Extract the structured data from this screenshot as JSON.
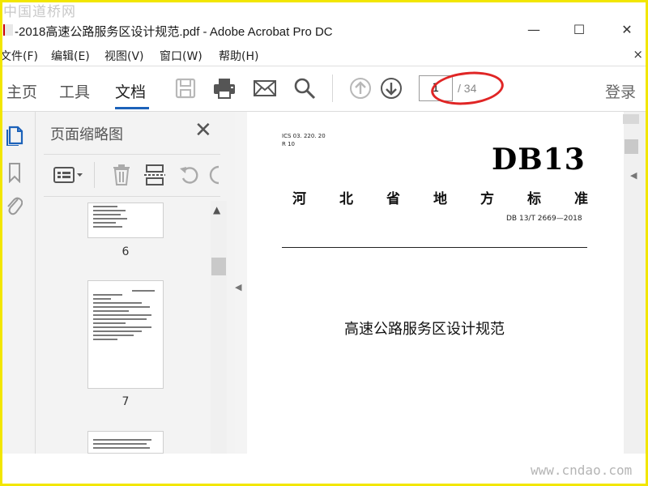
{
  "watermark_top": "中国道桥网",
  "watermark_bottom": "www.cndao.com",
  "window": {
    "title": "-2018高速公路服务区设计规范.pdf - Adobe Acrobat Pro DC",
    "minimize": "—",
    "maximize": "☐",
    "close": "✕"
  },
  "menu": {
    "items": [
      "文件(F)",
      "编辑(E)",
      "视图(V)",
      "窗口(W)",
      "帮助(H)"
    ],
    "close": "×"
  },
  "toolbar": {
    "tabs": [
      "主页",
      "工具",
      "文档"
    ],
    "active_tab": "文档",
    "icons": [
      "save-icon",
      "print-icon",
      "mail-icon",
      "search-icon",
      "page-up-icon",
      "page-down-icon"
    ],
    "page_current": "1",
    "page_total": "/ 34",
    "login": "登录"
  },
  "left_rail": {
    "icons": [
      "page-thumbnails-icon",
      "bookmark-icon",
      "attachment-icon"
    ]
  },
  "thumb_panel": {
    "title": "页面缩略图",
    "close": "✕",
    "tools": [
      "options-icon",
      "delete-icon",
      "insert-page-icon",
      "undo-icon",
      "redo-icon"
    ],
    "pages": [
      {
        "label": "6"
      },
      {
        "label": "7"
      }
    ]
  },
  "document": {
    "ics_line1": "ICS 03. 220. 20",
    "ics_line2": "R 10",
    "db_code": "DB13",
    "province_chars": [
      "河",
      "北",
      "省",
      "地",
      "方",
      "标",
      "准"
    ],
    "standard_code": "DB 13/T 2669—2018",
    "doc_title": "高速公路服务区设计规范"
  }
}
